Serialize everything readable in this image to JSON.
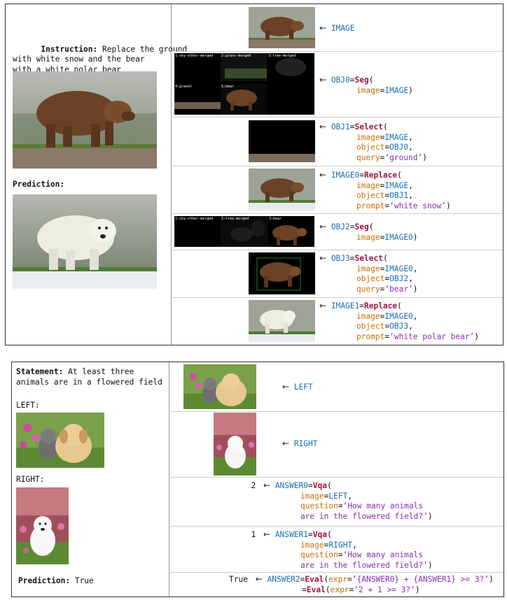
{
  "panel1": {
    "instruction_label": "Instruction:",
    "instruction_lines": [
      " Replace the ground",
      "with white snow and the bear",
      "with a white polar bear"
    ],
    "prediction_label": "Prediction:",
    "rows": [
      {
        "lines": [
          [
            {
              "t": "IMAGE",
              "c": "kw"
            }
          ]
        ]
      },
      {
        "seg_labels": [
          "1:sky-other-merged",
          "2:grass-merged",
          "3:tree-merged",
          "4:gravel",
          "5:bear"
        ],
        "lines": [
          [
            {
              "t": "OBJ0",
              "c": "kw"
            },
            {
              "t": "=",
              "c": ""
            },
            {
              "t": "Seg",
              "c": "fn"
            },
            {
              "t": "(",
              "c": ""
            }
          ],
          [
            {
              "t": "    image",
              "c": "arg"
            },
            {
              "t": "=",
              "c": ""
            },
            {
              "t": "IMAGE",
              "c": "kw"
            },
            {
              "t": ")",
              "c": ""
            }
          ]
        ]
      },
      {
        "lines": [
          [
            {
              "t": "OBJ1",
              "c": "kw"
            },
            {
              "t": "=",
              "c": ""
            },
            {
              "t": "Select",
              "c": "fn"
            },
            {
              "t": "(",
              "c": ""
            }
          ],
          [
            {
              "t": "    image",
              "c": "arg"
            },
            {
              "t": "=",
              "c": ""
            },
            {
              "t": "IMAGE",
              "c": "kw"
            },
            {
              "t": ",",
              "c": ""
            }
          ],
          [
            {
              "t": "    object",
              "c": "arg"
            },
            {
              "t": "=",
              "c": ""
            },
            {
              "t": "OBJ0",
              "c": "kw"
            },
            {
              "t": ",",
              "c": ""
            }
          ],
          [
            {
              "t": "    query",
              "c": "arg"
            },
            {
              "t": "=",
              "c": ""
            },
            {
              "t": "‘ground’",
              "c": "str"
            },
            {
              "t": ")",
              "c": ""
            }
          ]
        ]
      },
      {
        "lines": [
          [
            {
              "t": "IMAGE0",
              "c": "kw"
            },
            {
              "t": "=",
              "c": ""
            },
            {
              "t": "Replace",
              "c": "fn"
            },
            {
              "t": "(",
              "c": ""
            }
          ],
          [
            {
              "t": "    image",
              "c": "arg"
            },
            {
              "t": "=",
              "c": ""
            },
            {
              "t": "IMAGE",
              "c": "kw"
            },
            {
              "t": ",",
              "c": ""
            }
          ],
          [
            {
              "t": "    object",
              "c": "arg"
            },
            {
              "t": "=",
              "c": ""
            },
            {
              "t": "OBJ1",
              "c": "kw"
            },
            {
              "t": ",",
              "c": ""
            }
          ],
          [
            {
              "t": "    prompt",
              "c": "arg"
            },
            {
              "t": "=",
              "c": ""
            },
            {
              "t": "‘white snow’",
              "c": "str"
            },
            {
              "t": ")",
              "c": ""
            }
          ]
        ]
      },
      {
        "seg_labels": [
          "1:sky-other-merged",
          "2:tree-merged",
          "3:bear"
        ],
        "lines": [
          [
            {
              "t": "OBJ2",
              "c": "kw"
            },
            {
              "t": "=",
              "c": ""
            },
            {
              "t": "Seg",
              "c": "fn"
            },
            {
              "t": "(",
              "c": ""
            }
          ],
          [
            {
              "t": "    image",
              "c": "arg"
            },
            {
              "t": "=",
              "c": ""
            },
            {
              "t": "IMAGE0",
              "c": "kw"
            },
            {
              "t": ")",
              "c": ""
            }
          ]
        ]
      },
      {
        "lines": [
          [
            {
              "t": "OBJ3",
              "c": "kw"
            },
            {
              "t": "=",
              "c": ""
            },
            {
              "t": "Select",
              "c": "fn"
            },
            {
              "t": "(",
              "c": ""
            }
          ],
          [
            {
              "t": "    image",
              "c": "arg"
            },
            {
              "t": "=",
              "c": ""
            },
            {
              "t": "IMAGE0",
              "c": "kw"
            },
            {
              "t": ",",
              "c": ""
            }
          ],
          [
            {
              "t": "    object",
              "c": "arg"
            },
            {
              "t": "=",
              "c": ""
            },
            {
              "t": "OBJ2",
              "c": "kw"
            },
            {
              "t": ",",
              "c": ""
            }
          ],
          [
            {
              "t": "    query",
              "c": "arg"
            },
            {
              "t": "=",
              "c": ""
            },
            {
              "t": "‘bear’",
              "c": "str"
            },
            {
              "t": ")",
              "c": ""
            }
          ]
        ]
      },
      {
        "lines": [
          [
            {
              "t": "IMAGE1",
              "c": "kw"
            },
            {
              "t": "=",
              "c": ""
            },
            {
              "t": "Replace",
              "c": "fn"
            },
            {
              "t": "(",
              "c": ""
            }
          ],
          [
            {
              "t": "    image",
              "c": "arg"
            },
            {
              "t": "=",
              "c": ""
            },
            {
              "t": "IMAGE0",
              "c": "kw"
            },
            {
              "t": ",",
              "c": ""
            }
          ],
          [
            {
              "t": "    object",
              "c": "arg"
            },
            {
              "t": "=",
              "c": ""
            },
            {
              "t": "OBJ3",
              "c": "kw"
            },
            {
              "t": ",",
              "c": ""
            }
          ],
          [
            {
              "t": "    prompt",
              "c": "arg"
            },
            {
              "t": "=",
              "c": ""
            },
            {
              "t": "‘white polar bear’",
              "c": "str"
            },
            {
              "t": ")",
              "c": ""
            }
          ]
        ]
      }
    ]
  },
  "panel2": {
    "statement_label": "Statement:",
    "statement_lines": [
      " At least three",
      "animals are in a flowered field"
    ],
    "left_label": "LEFT:",
    "right_label": "RIGHT:",
    "prediction_label": "Prediction:",
    "prediction_value": " True",
    "rows": [
      {
        "result": "",
        "lines": [
          [
            {
              "t": "LEFT",
              "c": "kw"
            }
          ]
        ]
      },
      {
        "result": "",
        "lines": [
          [
            {
              "t": "RIGHT",
              "c": "kw"
            }
          ]
        ]
      },
      {
        "result": "2",
        "lines": [
          [
            {
              "t": "ANSWER0",
              "c": "kw"
            },
            {
              "t": "=",
              "c": ""
            },
            {
              "t": "Vqa",
              "c": "fn"
            },
            {
              "t": "(",
              "c": ""
            }
          ],
          [
            {
              "t": "    image",
              "c": "arg"
            },
            {
              "t": "=",
              "c": ""
            },
            {
              "t": "LEFT",
              "c": "kw"
            },
            {
              "t": ",",
              "c": ""
            }
          ],
          [
            {
              "t": "    question",
              "c": "arg"
            },
            {
              "t": "=",
              "c": ""
            },
            {
              "t": "‘How many animals",
              "c": "str"
            }
          ],
          [
            {
              "t": "    are in the flowered field?’",
              "c": "str"
            },
            {
              "t": ")",
              "c": ""
            }
          ]
        ]
      },
      {
        "result": "1",
        "lines": [
          [
            {
              "t": "ANSWER1",
              "c": "kw"
            },
            {
              "t": "=",
              "c": ""
            },
            {
              "t": "Vqa",
              "c": "fn"
            },
            {
              "t": "(",
              "c": ""
            }
          ],
          [
            {
              "t": "    image",
              "c": "arg"
            },
            {
              "t": "=",
              "c": ""
            },
            {
              "t": "RIGHT",
              "c": "kw"
            },
            {
              "t": ",",
              "c": ""
            }
          ],
          [
            {
              "t": "    question",
              "c": "arg"
            },
            {
              "t": "=",
              "c": ""
            },
            {
              "t": "‘How many animals",
              "c": "str"
            }
          ],
          [
            {
              "t": "    are in the flowered field?’",
              "c": "str"
            },
            {
              "t": ")",
              "c": ""
            }
          ]
        ]
      },
      {
        "result": "True",
        "lines": [
          [
            {
              "t": "ANSWER2",
              "c": "kw"
            },
            {
              "t": "=",
              "c": ""
            },
            {
              "t": "Eval",
              "c": "fn"
            },
            {
              "t": "(",
              "c": ""
            },
            {
              "t": "expr",
              "c": "arg"
            },
            {
              "t": "=",
              "c": ""
            },
            {
              "t": "‘{ANSWER0} + {ANSWER1} >= 3?’",
              "c": "str"
            },
            {
              "t": ")",
              "c": ""
            }
          ],
          [
            {
              "t": "       =",
              "c": ""
            },
            {
              "t": "Eval",
              "c": "fn"
            },
            {
              "t": "(",
              "c": ""
            },
            {
              "t": "expr",
              "c": "arg"
            },
            {
              "t": "=",
              "c": ""
            },
            {
              "t": "‘2 + 1 >= 3?’",
              "c": "str"
            },
            {
              "t": ")",
              "c": ""
            }
          ]
        ]
      }
    ]
  },
  "arrow_glyph": "←"
}
